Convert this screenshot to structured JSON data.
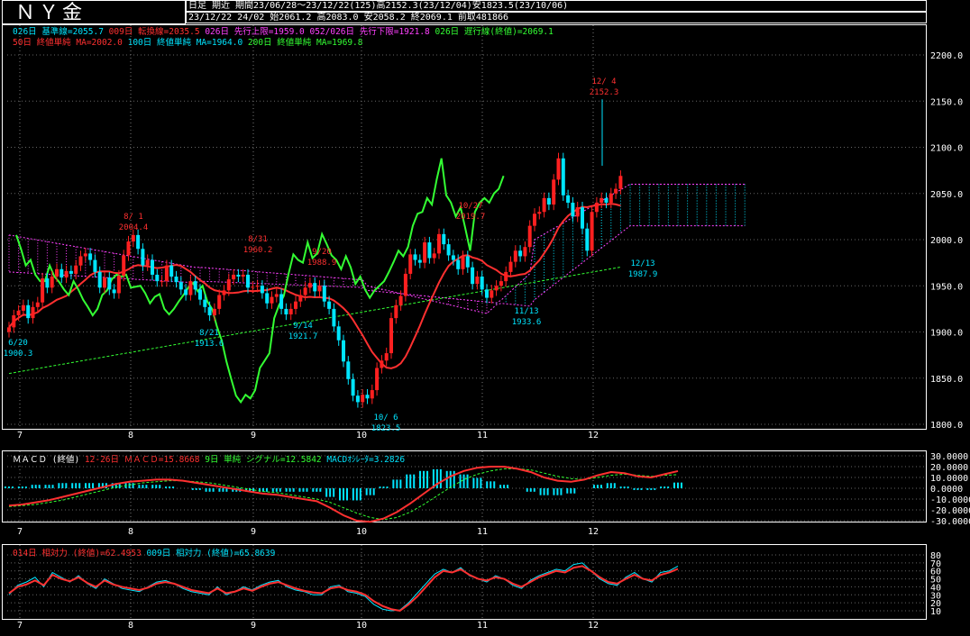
{
  "header": {
    "title": "ＮＹ金",
    "row1": "日足 期近 期間23/06/28～23/12/22(125)高2152.3(23/12/04)安1823.5(23/10/06)",
    "row2": "23/12/22 24/02 始2061.2 高2083.0 安2058.2 終2069.1 前取481866"
  },
  "legend_main_1": [
    {
      "text": "026日 基準線=2055.7",
      "color": "#00e5ff"
    },
    {
      "text": "009日 転換線=2035.5",
      "color": "#ff3030"
    },
    {
      "text": "026日 先行上限=1959.0",
      "color": "#ff40ff"
    },
    {
      "text": "052/026日 先行下限=1921.8",
      "color": "#ff40ff"
    },
    {
      "text": "026日 遅行線(終値)=2069.1",
      "color": "#33ff33"
    }
  ],
  "legend_main_2": [
    {
      "text": "50日 終値単純 MA=2002.0",
      "color": "#ff3030"
    },
    {
      "text": "100日 終値単純 MA=1964.0",
      "color": "#00e5ff"
    },
    {
      "text": "200日 終値単純 MA=1969.8",
      "color": "#33ff33"
    }
  ],
  "legend_macd": [
    {
      "text": "ＭＡＣＤ (終値)",
      "color": "#ffffff"
    },
    {
      "text": "12-26日 ＭＡＣＤ=15.8668",
      "color": "#ff3030"
    },
    {
      "text": "9日 単純 シグナル=12.5842",
      "color": "#33ff33"
    },
    {
      "text": "MACDｵｼﾚｰﾀ=3.2826",
      "color": "#00e5ff"
    }
  ],
  "legend_rsi": [
    {
      "text": "014日 相対力 (終値)=62.4953",
      "color": "#ff3030"
    },
    {
      "text": "009日 相対力 (終値)=65.8639",
      "color": "#00e5ff"
    }
  ],
  "chart_data": [
    {
      "type": "candlestick",
      "panel": "price",
      "x_ticks": [
        "7",
        "8",
        "9",
        "10",
        "11",
        "12"
      ],
      "y_ticks": [
        "2200.0",
        "2150.0",
        "2100.0",
        "2050.0",
        "2000.0",
        "1950.0",
        "1900.0",
        "1850.0",
        "1800.0"
      ],
      "ylim": [
        1800,
        2200
      ],
      "close": [
        1905,
        1918,
        1923,
        1929,
        1915,
        1927,
        1932,
        1958,
        1948,
        1960,
        1968,
        1959,
        1966,
        1963,
        1972,
        1982,
        1985,
        1978,
        1965,
        1948,
        1959,
        1946,
        1942,
        1961,
        1983,
        1998,
        2005,
        1990,
        1972,
        1978,
        1962,
        1955,
        1955,
        1972,
        1960,
        1954,
        1946,
        1940,
        1955,
        1946,
        1935,
        1927,
        1918,
        1925,
        1940,
        1945,
        1957,
        1962,
        1960,
        1962,
        1948,
        1949,
        1950,
        1942,
        1931,
        1938,
        1941,
        1925,
        1919,
        1925,
        1933,
        1940,
        1948,
        1953,
        1944,
        1950,
        1933,
        1925,
        1906,
        1891,
        1868,
        1849,
        1831,
        1824,
        1832,
        1828,
        1837,
        1861,
        1869,
        1877,
        1915,
        1929,
        1939,
        1963,
        1984,
        1978,
        1975,
        1997,
        1980,
        1985,
        2006,
        1995,
        1983,
        1978,
        1968,
        1982,
        1970,
        1952,
        1960,
        1946,
        1937,
        1945,
        1950,
        1955,
        1965,
        1976,
        1988,
        1982,
        1992,
        2015,
        2028,
        2030,
        2045,
        2038,
        2065,
        2088,
        2048,
        2040,
        2025,
        2035,
        2012,
        1988,
        2030,
        2040,
        2045,
        2040,
        2050,
        2055,
        2069
      ],
      "annotations": [
        {
          "label": "6/20",
          "value": "1900.3"
        },
        {
          "label": "8/ 1",
          "value": "2004.4"
        },
        {
          "label": "8/21",
          "value": "1913.6"
        },
        {
          "label": "8/31",
          "value": "1960.2"
        },
        {
          "label": "9/14",
          "value": "1921.7"
        },
        {
          "label": "9/20",
          "value": "1988.9"
        },
        {
          "label": "10/ 6",
          "value": "1823.5"
        },
        {
          "label": "10/27",
          "value": "2019.7"
        },
        {
          "label": "11/13",
          "value": "1933.6"
        },
        {
          "label": "12/ 4",
          "value": "2152.3"
        },
        {
          "label": "12/13",
          "value": "1987.9"
        }
      ]
    },
    {
      "type": "line",
      "panel": "macd",
      "y_ticks": [
        "30.0000",
        "20.0000",
        "10.0000",
        "0.0000",
        "-10.0000",
        "-20.0000",
        "-30.0000"
      ],
      "ylim": [
        -30,
        30
      ],
      "macd": [
        -16,
        -15,
        -13,
        -11,
        -8,
        -5,
        -2,
        1,
        4,
        6,
        7,
        8,
        8,
        7,
        5,
        3,
        1,
        -1,
        -3,
        -5,
        -6,
        -8,
        -10,
        -12,
        -18,
        -25,
        -30,
        -31,
        -28,
        -22,
        -14,
        -5,
        4,
        11,
        16,
        19,
        20,
        20,
        18,
        15,
        10,
        7,
        6,
        8,
        12,
        15,
        14,
        11,
        10,
        13,
        15.9
      ],
      "signal": [
        -17,
        -16,
        -15,
        -13,
        -11,
        -8,
        -5,
        -2,
        1,
        3,
        5,
        6,
        7,
        7,
        6,
        5,
        3,
        1,
        -1,
        -3,
        -4,
        -6,
        -8,
        -10,
        -13,
        -18,
        -23,
        -27,
        -29,
        -27,
        -22,
        -15,
        -7,
        1,
        8,
        13,
        16,
        18,
        18,
        17,
        14,
        11,
        9,
        8,
        10,
        12,
        13,
        12,
        11,
        12,
        12.6
      ]
    },
    {
      "type": "line",
      "panel": "rsi",
      "y_ticks": [
        "80",
        "70",
        "60",
        "50",
        "40",
        "30",
        "20",
        "10"
      ],
      "ylim": [
        10,
        80
      ],
      "rsi14": [
        32,
        40,
        43,
        48,
        42,
        55,
        50,
        47,
        52,
        45,
        40,
        48,
        43,
        40,
        38,
        36,
        39,
        44,
        46,
        44,
        40,
        36,
        34,
        32,
        38,
        32,
        34,
        38,
        35,
        40,
        44,
        46,
        42,
        38,
        35,
        33,
        32,
        38,
        40,
        36,
        34,
        30,
        22,
        16,
        12,
        10,
        18,
        28,
        40,
        52,
        60,
        58,
        62,
        55,
        50,
        48,
        52,
        50,
        44,
        40,
        46,
        52,
        56,
        60,
        58,
        64,
        66,
        60,
        52,
        46,
        44,
        50,
        55,
        50,
        48,
        55,
        58,
        62.5
      ],
      "rsi9": [
        30,
        42,
        46,
        52,
        40,
        58,
        52,
        46,
        54,
        44,
        38,
        50,
        44,
        38,
        36,
        34,
        40,
        46,
        48,
        44,
        38,
        34,
        32,
        30,
        40,
        30,
        34,
        40,
        36,
        42,
        46,
        48,
        40,
        36,
        34,
        30,
        30,
        40,
        42,
        34,
        32,
        28,
        18,
        12,
        10,
        11,
        20,
        32,
        44,
        56,
        62,
        58,
        64,
        54,
        50,
        46,
        54,
        50,
        42,
        38,
        48,
        54,
        58,
        62,
        60,
        68,
        70,
        60,
        50,
        44,
        42,
        52,
        58,
        50,
        46,
        58,
        60,
        65.9
      ]
    }
  ]
}
